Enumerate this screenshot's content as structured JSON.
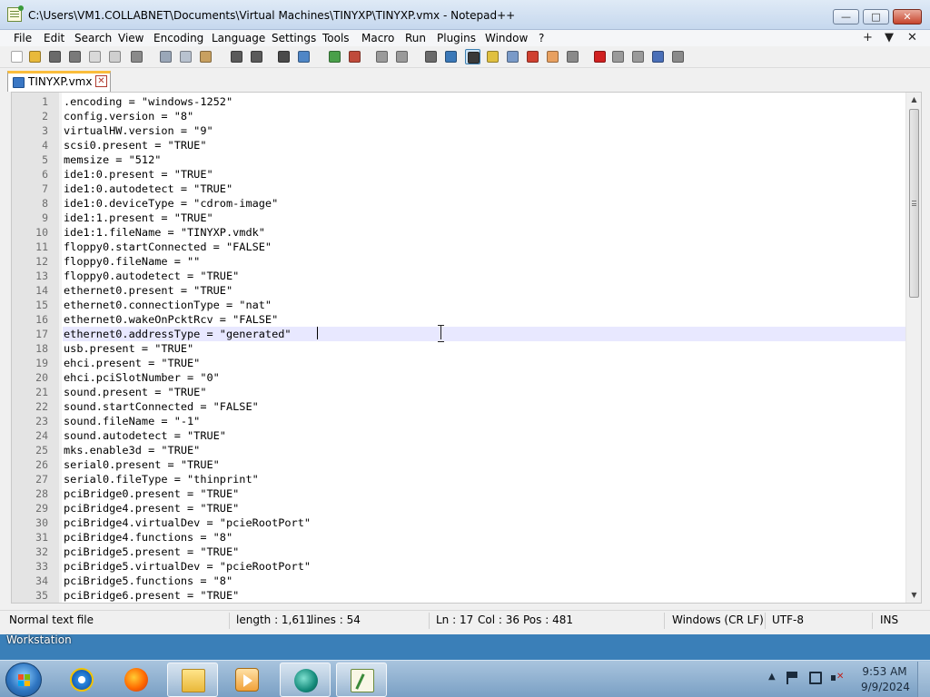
{
  "window": {
    "title": "C:\\Users\\VM1.COLLABNET\\Documents\\Virtual Machines\\TINYXP\\TINYXP.vmx - Notepad++",
    "minimize_glyph": "—",
    "maximize_glyph": "□",
    "close_glyph": "✕"
  },
  "menu": {
    "items": [
      "File",
      "Edit",
      "Search",
      "View",
      "Encoding",
      "Language",
      "Settings",
      "Tools",
      "Macro",
      "Run",
      "Plugins",
      "Window",
      "?"
    ],
    "right_plus": "+",
    "right_down": "▼",
    "right_close": "✕"
  },
  "toolbar": {
    "icons": [
      {
        "name": "new-file-icon",
        "color": "#ffffff"
      },
      {
        "name": "open-file-icon",
        "color": "#e8b93a"
      },
      {
        "name": "save-icon",
        "color": "#6a6a6a"
      },
      {
        "name": "save-all-icon",
        "color": "#7a7a7a"
      },
      {
        "name": "close-icon",
        "color": "#d9d9d9"
      },
      {
        "name": "close-all-icon",
        "color": "#cfcfcf"
      },
      {
        "name": "print-icon",
        "color": "#8a8a8a"
      },
      {
        "name": "cut-icon",
        "color": "#9aa7b8"
      },
      {
        "name": "copy-icon",
        "color": "#b8c2cf"
      },
      {
        "name": "paste-icon",
        "color": "#c8a060"
      },
      {
        "name": "undo-icon",
        "color": "#5a5a5a"
      },
      {
        "name": "redo-icon",
        "color": "#5a5a5a"
      },
      {
        "name": "find-icon",
        "color": "#4a4a4a"
      },
      {
        "name": "replace-icon",
        "color": "#4f86c6"
      },
      {
        "name": "zoom-in-icon",
        "color": "#4aa04a"
      },
      {
        "name": "zoom-out-icon",
        "color": "#c04a3a"
      },
      {
        "name": "sync-vertical-icon",
        "color": "#9a9a9a"
      },
      {
        "name": "sync-horizontal-icon",
        "color": "#9a9a9a"
      },
      {
        "name": "word-wrap-icon",
        "color": "#6a6a6a"
      },
      {
        "name": "show-all-chars-icon",
        "color": "#3a78b8"
      },
      {
        "name": "indent-guide-icon",
        "color": "#3a3a3a"
      },
      {
        "name": "language-xml-icon",
        "color": "#e0c040"
      },
      {
        "name": "doc-map-icon",
        "color": "#7a9ac8"
      },
      {
        "name": "function-list-icon",
        "color": "#d04030"
      },
      {
        "name": "folder-workspace-icon",
        "color": "#e8a060"
      },
      {
        "name": "monitoring-icon",
        "color": "#8a8a8a"
      },
      {
        "name": "record-macro-icon",
        "color": "#d02020"
      },
      {
        "name": "stop-recording-icon",
        "color": "#9a9a9a"
      },
      {
        "name": "playback-icon",
        "color": "#9a9a9a"
      },
      {
        "name": "run-macro-multiple-icon",
        "color": "#4a6fb8"
      },
      {
        "name": "save-macro-icon",
        "color": "#8a8a8a"
      }
    ]
  },
  "tab": {
    "label": "TINYXP.vmx",
    "close_glyph": "✕"
  },
  "editor": {
    "current_line": 17,
    "lines": [
      ".encoding = \"windows-1252\"",
      "config.version = \"8\"",
      "virtualHW.version = \"9\"",
      "scsi0.present = \"TRUE\"",
      "memsize = \"512\"",
      "ide1:0.present = \"TRUE\"",
      "ide1:0.autodetect = \"TRUE\"",
      "ide1:0.deviceType = \"cdrom-image\"",
      "ide1:1.present = \"TRUE\"",
      "ide1:1.fileName = \"TINYXP.vmdk\"",
      "floppy0.startConnected = \"FALSE\"",
      "floppy0.fileName = \"\"",
      "floppy0.autodetect = \"TRUE\"",
      "ethernet0.present = \"TRUE\"",
      "ethernet0.connectionType = \"nat\"",
      "ethernet0.wakeOnPcktRcv = \"FALSE\"",
      "ethernet0.addressType = \"generated\"",
      "usb.present = \"TRUE\"",
      "ehci.present = \"TRUE\"",
      "ehci.pciSlotNumber = \"0\"",
      "sound.present = \"TRUE\"",
      "sound.startConnected = \"FALSE\"",
      "sound.fileName = \"-1\"",
      "sound.autodetect = \"TRUE\"",
      "mks.enable3d = \"TRUE\"",
      "serial0.present = \"TRUE\"",
      "serial0.fileType = \"thinprint\"",
      "pciBridge0.present = \"TRUE\"",
      "pciBridge4.present = \"TRUE\"",
      "pciBridge4.virtualDev = \"pcieRootPort\"",
      "pciBridge4.functions = \"8\"",
      "pciBridge5.present = \"TRUE\"",
      "pciBridge5.virtualDev = \"pcieRootPort\"",
      "pciBridge5.functions = \"8\"",
      "pciBridge6.present = \"TRUE\""
    ]
  },
  "statusbar": {
    "file_type": "Normal text file",
    "length": "length : 1,611",
    "lines": "lines : 54",
    "ln": "Ln : 17",
    "col": "Col : 36",
    "pos": "Pos : 481",
    "eol": "Windows (CR LF)",
    "encoding": "UTF-8",
    "insert_mode": "INS"
  },
  "desktop": {
    "workstation_label": "Workstation"
  },
  "taskbar": {
    "tray_chevron": "▲",
    "time": "9:53 AM",
    "date": "9/9/2024"
  }
}
